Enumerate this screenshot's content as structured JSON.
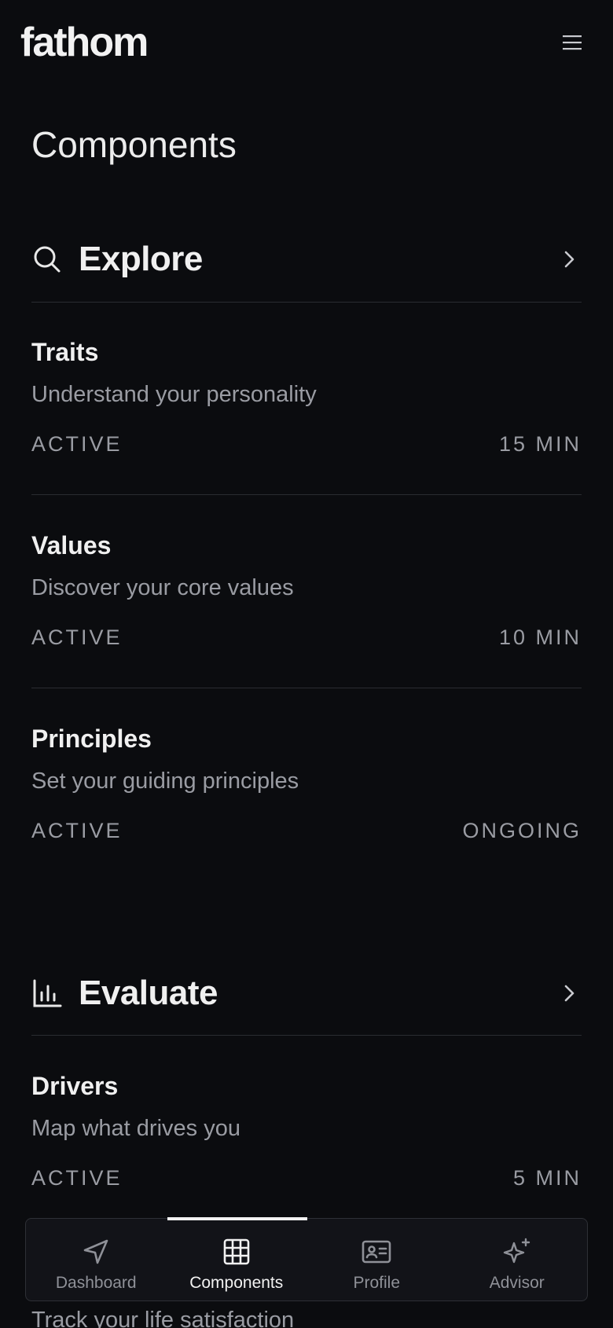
{
  "app": {
    "logo_text": "fathom"
  },
  "header": {
    "menu_icon": "hamburger-menu-icon"
  },
  "page": {
    "title": "Components"
  },
  "sections": [
    {
      "title": "Explore",
      "icon": "search-icon",
      "items": [
        {
          "title": "Traits",
          "description": "Understand your personality",
          "status": "ACTIVE",
          "time": "15 MIN"
        },
        {
          "title": "Values",
          "description": "Discover your core values",
          "status": "ACTIVE",
          "time": "10 MIN"
        },
        {
          "title": "Principles",
          "description": "Set your guiding principles",
          "status": "ACTIVE",
          "time": "ONGOING"
        }
      ]
    },
    {
      "title": "Evaluate",
      "icon": "bar-chart-icon",
      "items": [
        {
          "title": "Drivers",
          "description": "Map what drives you",
          "status": "ACTIVE",
          "time": "5 MIN"
        }
      ],
      "peek_text": "Track your life satisfaction"
    }
  ],
  "bottom_nav": {
    "items": [
      {
        "label": "Dashboard",
        "icon": "navigation-arrow-icon",
        "active": false
      },
      {
        "label": "Components",
        "icon": "grid-icon",
        "active": true
      },
      {
        "label": "Profile",
        "icon": "id-card-icon",
        "active": false
      },
      {
        "label": "Advisor",
        "icon": "sparkles-icon",
        "active": false
      }
    ]
  },
  "colors": {
    "background": "#0b0c0f",
    "text_primary": "#f0f0f0",
    "text_muted": "#9a9ca3",
    "divider": "#2a2c31",
    "nav_background": "#121318"
  }
}
